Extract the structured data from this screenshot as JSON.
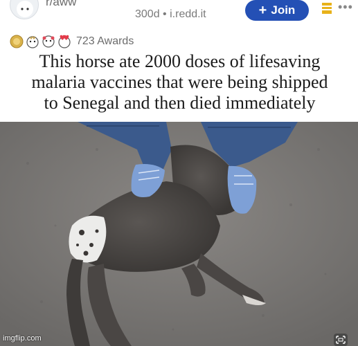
{
  "header": {
    "subreddit": "r/aww",
    "age": "300d",
    "separator": "•",
    "domain": "i.redd.it",
    "join_label": "Join",
    "join_plus": "+",
    "more": "•••"
  },
  "awards": {
    "count_label": "723 Awards",
    "icons": [
      "coin-award-icon",
      "wholesome-award-icon",
      "hug-award-icon",
      "heart-eyes-award-icon"
    ]
  },
  "post": {
    "title_line1": "This horse ate 2000 doses of lifesaving",
    "title_line2": "malaria vaccines that were being shipped",
    "title_line3": "to Senegal and then died immediately"
  },
  "image": {
    "watermark": "imgflip.com"
  },
  "colors": {
    "join_button": "#2450b5",
    "save_icon": "#e8b21a",
    "ground": "#7d7b78",
    "jeans": "#3b5a8c",
    "shoes": "#7ea0d6",
    "foal": "#4a4644"
  }
}
